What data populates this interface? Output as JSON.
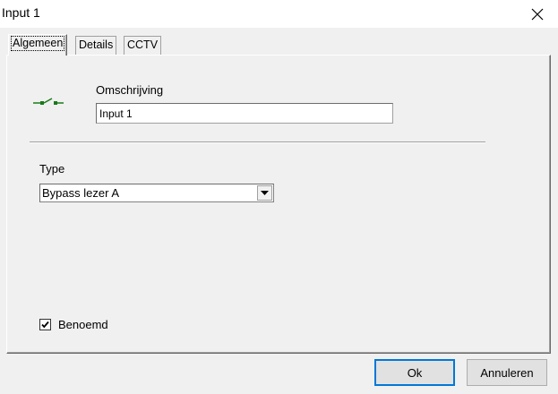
{
  "window": {
    "title": "Input 1",
    "close_icon": "close-icon"
  },
  "tabs": [
    {
      "label": "Algemeen",
      "active": true
    },
    {
      "label": "Details",
      "active": false
    },
    {
      "label": "CCTV",
      "active": false
    }
  ],
  "general": {
    "input_icon": "switch-icon",
    "description_label": "Omschrijving",
    "description_value": "Input 1",
    "type_label": "Type",
    "type_value": "Bypass lezer A",
    "named_label": "Benoemd",
    "named_checked": true
  },
  "buttons": {
    "ok_label": "Ok",
    "cancel_label": "Annuleren"
  },
  "colors": {
    "icon_green": "#1a7a1a",
    "default_button_border": "#0078d7"
  }
}
